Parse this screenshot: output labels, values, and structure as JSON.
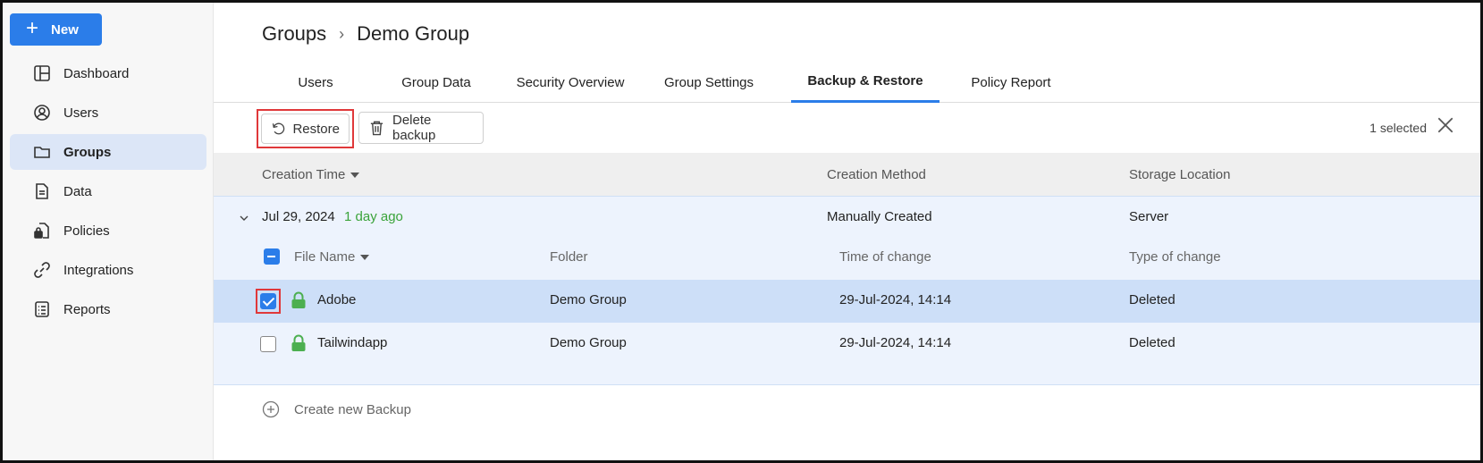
{
  "sidebar": {
    "new_label": "New",
    "items": [
      {
        "label": "Dashboard",
        "icon": "dashboard-icon"
      },
      {
        "label": "Users",
        "icon": "user-icon"
      },
      {
        "label": "Groups",
        "icon": "folder-icon",
        "active": true
      },
      {
        "label": "Data",
        "icon": "document-icon"
      },
      {
        "label": "Policies",
        "icon": "lock-doc-icon"
      },
      {
        "label": "Integrations",
        "icon": "link-icon"
      },
      {
        "label": "Reports",
        "icon": "report-icon"
      }
    ]
  },
  "breadcrumb": {
    "root": "Groups",
    "current": "Demo Group"
  },
  "tabs": [
    {
      "label": "Users"
    },
    {
      "label": "Group Data"
    },
    {
      "label": "Security Overview"
    },
    {
      "label": "Group Settings"
    },
    {
      "label": "Backup & Restore",
      "active": true
    },
    {
      "label": "Policy Report"
    }
  ],
  "toolbar": {
    "restore_label": "Restore",
    "delete_label": "Delete backup",
    "selected_text": "1 selected"
  },
  "table": {
    "headers": {
      "creation_time": "Creation Time",
      "creation_method": "Creation Method",
      "storage_location": "Storage Location"
    },
    "group": {
      "date": "Jul 29, 2024",
      "relative": "1 day ago",
      "method": "Manually Created",
      "location": "Server",
      "sub_headers": {
        "file_name": "File Name",
        "folder": "Folder",
        "time_of_change": "Time of change",
        "type_of_change": "Type of change"
      },
      "rows": [
        {
          "name": "Adobe",
          "folder": "Demo Group",
          "time": "29-Jul-2024, 14:14",
          "type": "Deleted",
          "selected": true
        },
        {
          "name": "Tailwindapp",
          "folder": "Demo Group",
          "time": "29-Jul-2024, 14:14",
          "type": "Deleted",
          "selected": false
        }
      ]
    }
  },
  "create_backup_label": "Create new Backup",
  "colors": {
    "accent": "#2b7de9",
    "highlight": "#e0383a",
    "lock_green": "#4caf50"
  }
}
